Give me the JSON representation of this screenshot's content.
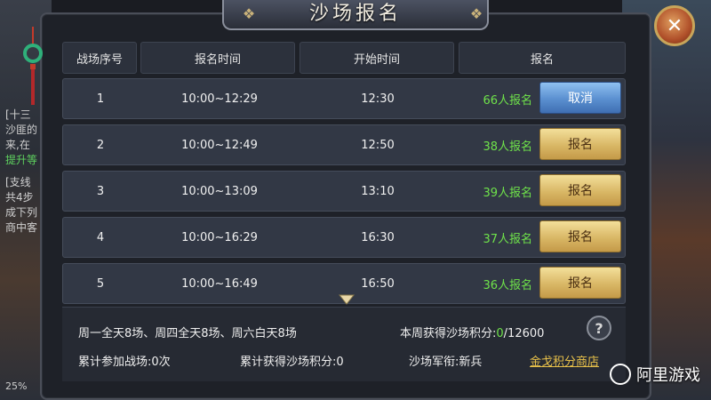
{
  "background": {
    "left_lines": [
      {
        "text": "[十三",
        "green": false
      },
      {
        "text": "沙匪的",
        "green": false
      },
      {
        "text": "来,在",
        "green": false
      },
      {
        "text": "提升等",
        "green": true
      },
      {
        "text": "[支线",
        "green": false
      },
      {
        "text": "共4步",
        "green": false
      },
      {
        "text": "成下列",
        "green": false
      },
      {
        "text": "商中客",
        "green": false
      }
    ],
    "left_percent": "25%"
  },
  "dialog": {
    "title": "沙场报名",
    "close_glyph": "✕"
  },
  "table": {
    "headers": [
      "战场序号",
      "报名时间",
      "开始时间",
      "报名"
    ],
    "rows": [
      {
        "id": "1",
        "signup": "10:00~12:29",
        "start": "12:30",
        "count": "66人报名",
        "button": "取消",
        "style": "blue"
      },
      {
        "id": "2",
        "signup": "10:00~12:49",
        "start": "12:50",
        "count": "38人报名",
        "button": "报名",
        "style": "gold"
      },
      {
        "id": "3",
        "signup": "10:00~13:09",
        "start": "13:10",
        "count": "39人报名",
        "button": "报名",
        "style": "gold"
      },
      {
        "id": "4",
        "signup": "10:00~16:29",
        "start": "16:30",
        "count": "37人报名",
        "button": "报名",
        "style": "gold"
      },
      {
        "id": "5",
        "signup": "10:00~16:49",
        "start": "16:50",
        "count": "36人报名",
        "button": "报名",
        "style": "gold"
      }
    ]
  },
  "footer": {
    "schedule": "周一全天8场、周四全天8场、周六白天8场",
    "weekly_points_label": "本周获得沙场积分:",
    "weekly_points_value": "0",
    "weekly_points_max": "/12600",
    "battles_label": "累计参加战场:",
    "battles_value": "0次",
    "total_points_label": "累计获得沙场积分:",
    "total_points_value": "0",
    "rank_label": "沙场军衔:",
    "rank_value": "新兵",
    "shop_link": "金戈积分商店",
    "help_glyph": "?"
  },
  "watermark": {
    "text": "阿里游戏"
  },
  "colors": {
    "count_green": "#6fe34a",
    "gold_button": "#d9b766",
    "blue_button": "#5a8fd0",
    "link_gold": "#e8c14a"
  }
}
